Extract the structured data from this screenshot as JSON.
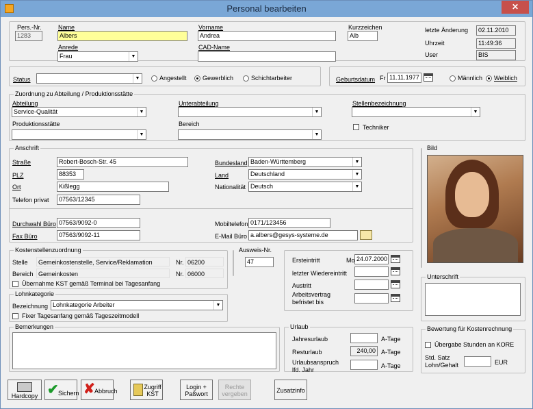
{
  "window": {
    "title": "Personal bearbeiten",
    "close": "✕"
  },
  "header": {
    "persnr_label": "Pers.-Nr.",
    "persnr": "1283",
    "name_label": "Name",
    "name": "Albers",
    "vorname_label": "Vorname",
    "vorname": "Andrea",
    "kurz_label": "Kurzzeichen",
    "kurz": "Alb",
    "anrede_label": "Anrede",
    "anrede": "Frau",
    "cadname_label": "CAD-Name",
    "cadname": "",
    "change_label": "letzte Änderung",
    "change_date": "02.11.2010",
    "time_label": "Uhrzeit",
    "time": "11:49:36",
    "user_label": "User",
    "user": "BIS"
  },
  "status": {
    "label": "Status",
    "value": "",
    "opt1": "Angestellt",
    "opt2": "Gewerblich",
    "opt3": "Schichtarbeiter"
  },
  "birth": {
    "label": "Geburtsdatum",
    "day": "Fr",
    "date": "11.11.1977",
    "male": "Männlich",
    "female": "Weiblich"
  },
  "dept": {
    "group": "Zuordnung zu Abteilung / Produktionsstätte",
    "abt_label": "Abteilung",
    "abt": "Service-Qualität",
    "unter_label": "Unterabteilung",
    "unter": "",
    "stelle_label": "Stellenbezeichnung",
    "stelle": "",
    "prod_label": "Produktionsstätte",
    "prod": "",
    "bereich_label": "Bereich",
    "bereich": "",
    "techniker": "Techniker"
  },
  "addr": {
    "group": "Anschrift",
    "strasse_label": "Straße",
    "strasse": "Robert-Bosch-Str. 45",
    "plz_label": "PLZ",
    "plz": "88353",
    "ort_label": "Ort",
    "ort": "Kißlegg",
    "tel_label": "Telefon privat",
    "tel": "07563/12345",
    "bl_label": "Bundesland",
    "bl": "Baden-Württemberg",
    "land_label": "Land",
    "land": "Deutschland",
    "nat_label": "Nationalität",
    "nat": "Deutsch",
    "dw_label": "Durchwahl Büro",
    "dw": "07563/9092-0",
    "fax_label": "Fax Büro",
    "fax": "07563/9092-11",
    "mobil_label": "Mobiltelefon",
    "mobil": "0171/123456",
    "email_label": "E-Mail Büro",
    "email": "a.albers@gesys-systeme.de"
  },
  "bild": {
    "label": "Bild"
  },
  "kst": {
    "group": "Kostenstellenzuordnung",
    "stelle_label": "Stelle",
    "stelle": "Gemeinkostenstelle, Service/Reklamation",
    "nr_label": "Nr.",
    "stelle_nr": "06200",
    "bereich_label": "Bereich",
    "bereich": "Gemeinkosten",
    "bereich_nr": "06000",
    "uebernahme": "Übernahme KST gemäß Terminal bei Tagesanfang"
  },
  "ausweis": {
    "label": "Ausweis-Nr.",
    "value": "47"
  },
  "dates": {
    "eintritt_label": "Ersteintritt",
    "eintritt_day": "Mo",
    "eintritt": "24.07.2000",
    "wieder_label": "letzter Wiedereintritt",
    "austritt_label": "Austritt",
    "vertrag_label": "Arbeitsvertrag befristet bis"
  },
  "lohn": {
    "group": "Lohnkategorie",
    "bez_label": "Bezeichnung",
    "bez": "Lohnkategorie Arbeiter",
    "fixer": "Fixer Tagesanfang gemäß Tageszeitmodell"
  },
  "unterschrift": {
    "label": "Unterschrift"
  },
  "bem": {
    "label": "Bemerkungen",
    "value": ""
  },
  "urlaub": {
    "group": "Urlaub",
    "jahr_label": "Jahresurlaub",
    "jahr": "",
    "rest_label": "Resturlaub",
    "rest": "240,00",
    "anspruch_label": "Urlaubsanspruch lfd. Jahr",
    "anspruch": "",
    "unit": "A-Tage"
  },
  "bewertung": {
    "group": "Bewertung für Kostenrechnung",
    "uebergabe": "Übergabe Stunden an KORE",
    "satz_label": "Std. Satz Lohn/Gehalt",
    "satz": "",
    "unit": "EUR"
  },
  "buttons": {
    "hardcopy": "Hardcopy",
    "sichern": "Sichern",
    "abbruch": "Abbruch",
    "zugriff": "Zugriff KST",
    "login": "Login + Paßwort",
    "rechte": "Rechte vergeben",
    "zusatz": "Zusatzinfo"
  },
  "colors": {
    "title": "#7aa7d6",
    "close": "#c7504b",
    "highlight": "#ffff99"
  }
}
